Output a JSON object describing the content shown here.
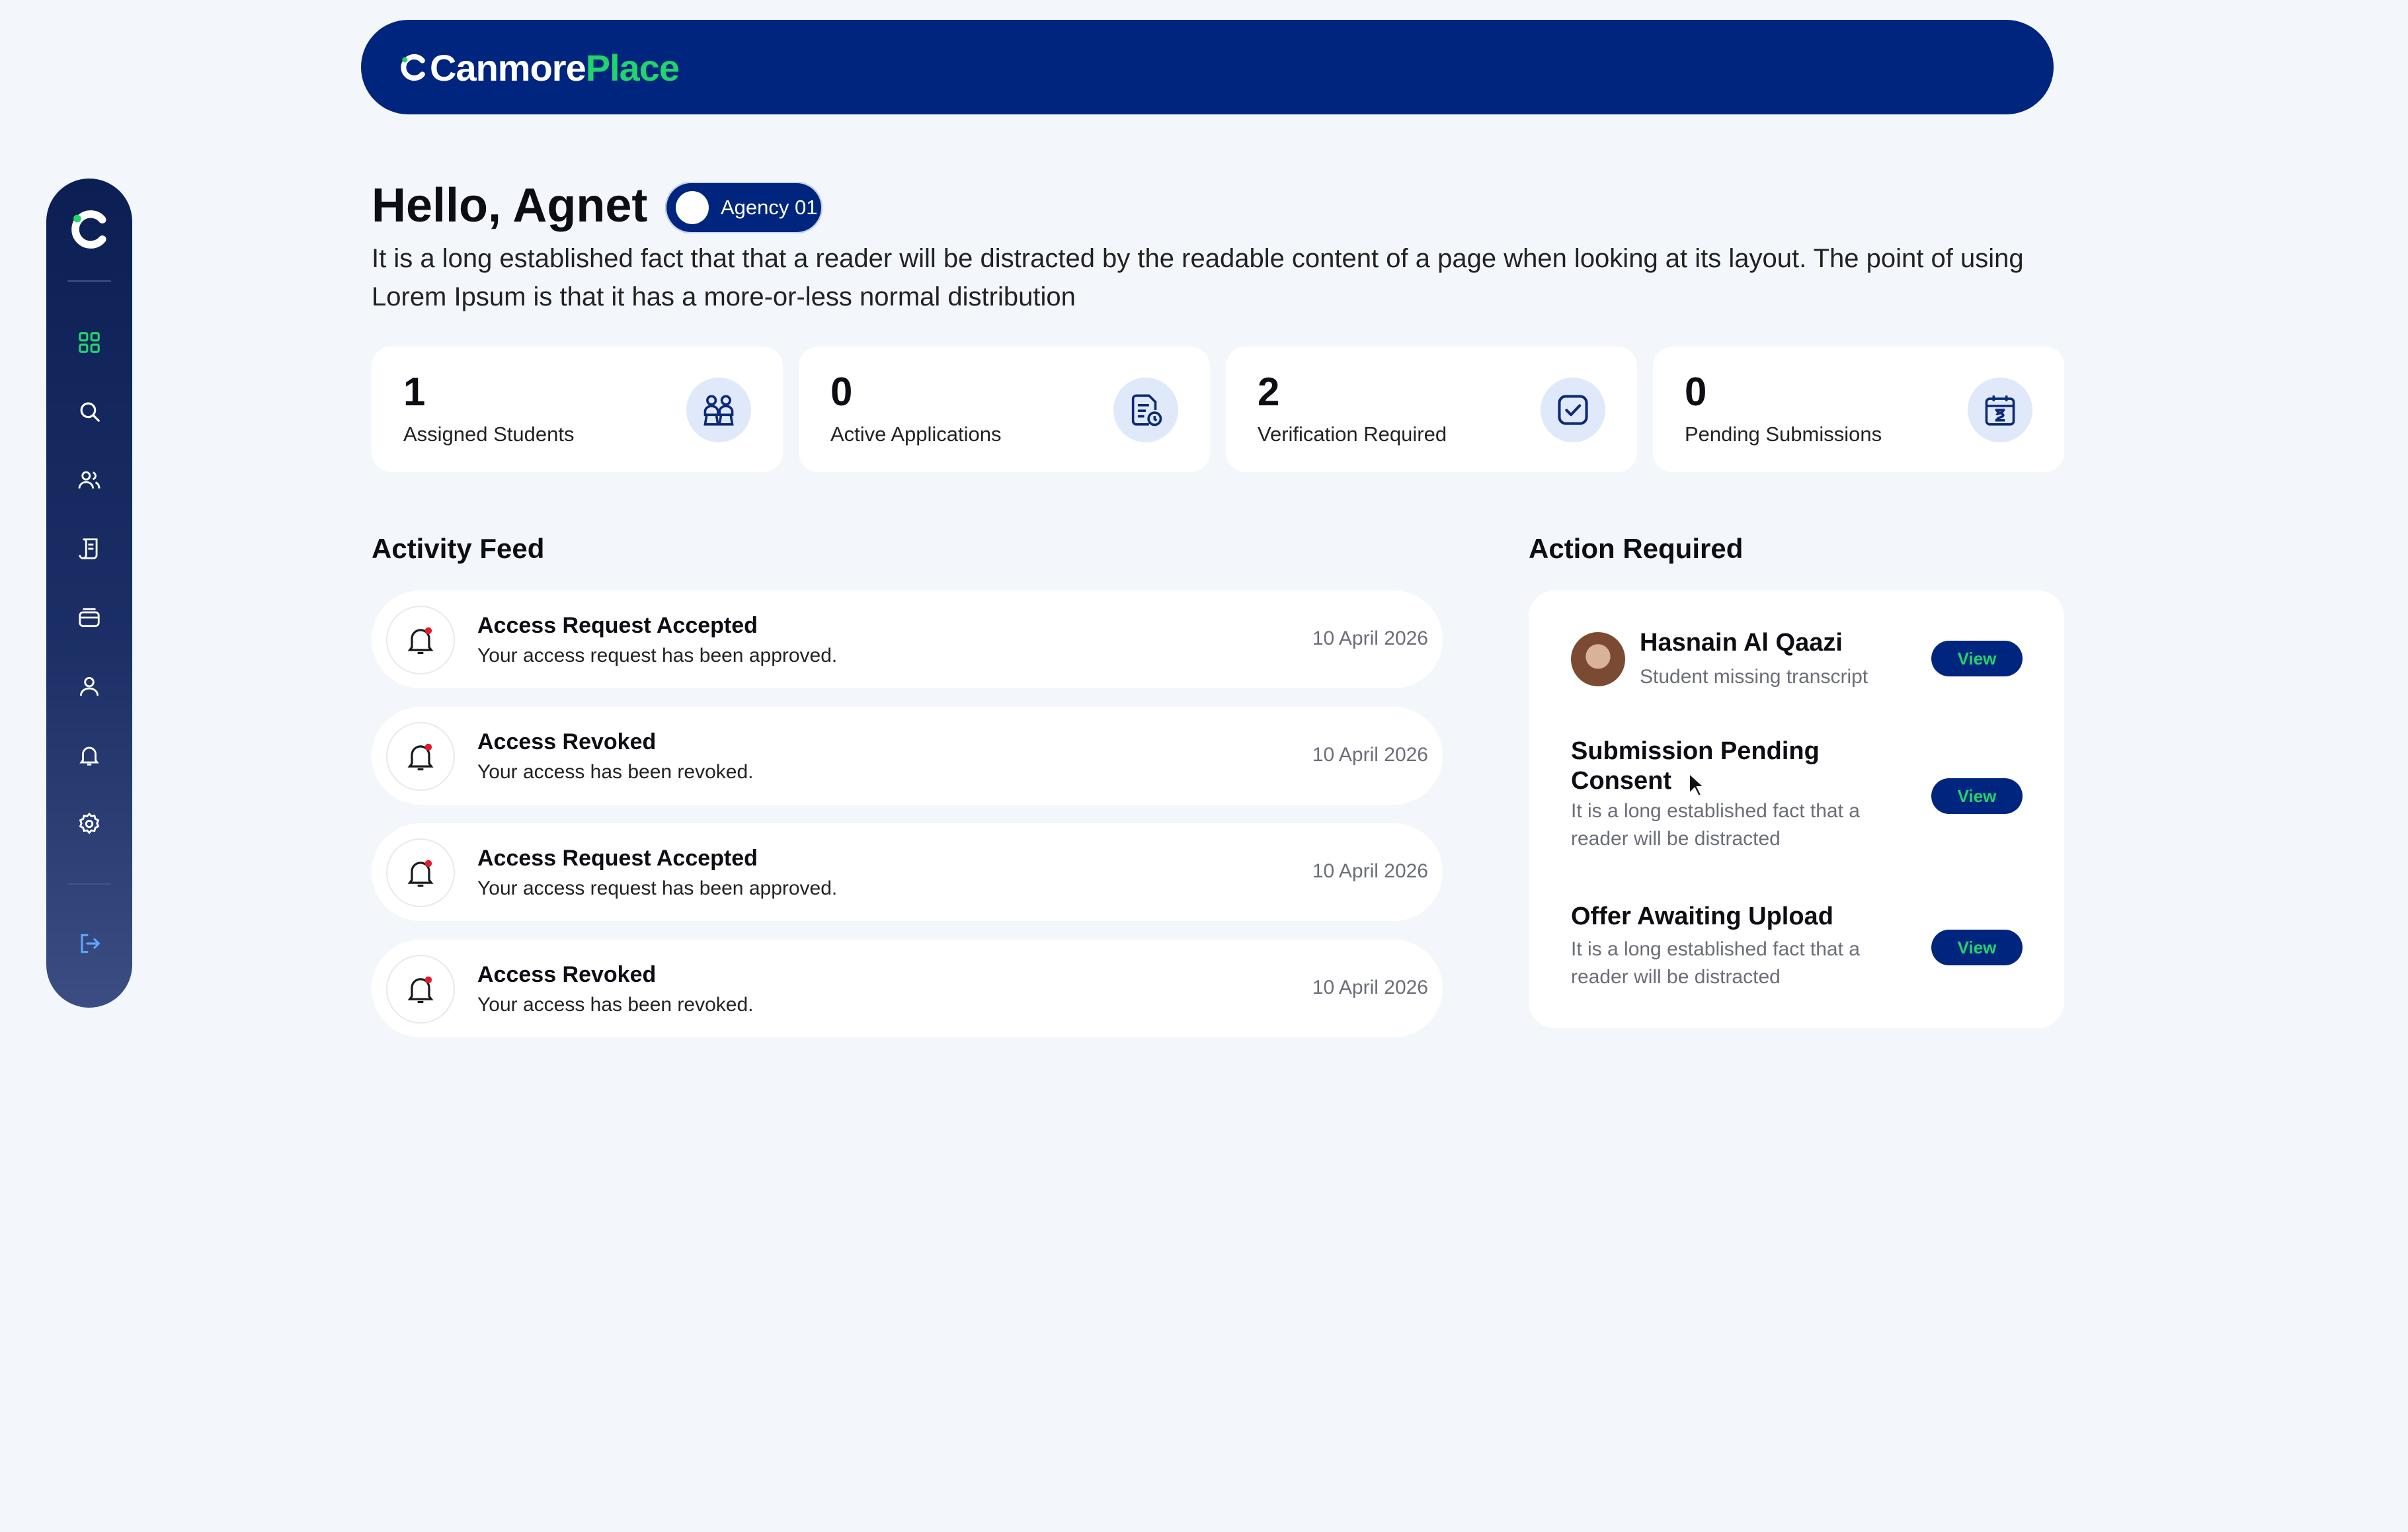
{
  "brand": {
    "name_part1": "Canmore",
    "name_part2": "Place",
    "accent": "#22d46b",
    "primary": "#00257e"
  },
  "sidebar": {
    "items": [
      {
        "icon": "dashboard-icon",
        "active": true
      },
      {
        "icon": "search-icon"
      },
      {
        "icon": "users-icon"
      },
      {
        "icon": "document-list-icon"
      },
      {
        "icon": "inbox-icon"
      },
      {
        "icon": "user-icon"
      },
      {
        "icon": "bell-icon"
      },
      {
        "icon": "gear-icon"
      },
      {
        "icon": "logout-icon"
      }
    ]
  },
  "greeting": {
    "title": "Hello, Agnet",
    "agency": "Agency 01",
    "intro": "It is a long established fact that that a reader will be distracted by the readable content of a page when looking at its layout. The point of using Lorem Ipsum is that it has a more-or-less normal distribution"
  },
  "stats": [
    {
      "value": "1",
      "label": "Assigned Students",
      "icon": "students-icon"
    },
    {
      "value": "0",
      "label": "Active Applications",
      "icon": "application-icon"
    },
    {
      "value": "2",
      "label": "Verification Required",
      "icon": "verify-check-icon"
    },
    {
      "value": "0",
      "label": "Pending Submissions",
      "icon": "calendar-pending-icon"
    }
  ],
  "activity": {
    "title": "Activity Feed",
    "items": [
      {
        "title": "Access Request Accepted",
        "subtitle": "Your access request has been approved.",
        "date": "10 April 2026"
      },
      {
        "title": "Access Revoked",
        "subtitle": "Your access has been revoked.",
        "date": "10 April 2026"
      },
      {
        "title": "Access Request Accepted",
        "subtitle": "Your access request has been approved.",
        "date": "10 April 2026"
      },
      {
        "title": "Access Revoked",
        "subtitle": "Your access has been revoked.",
        "date": "10 April 2026"
      }
    ]
  },
  "actions": {
    "title": "Action Required",
    "items": [
      {
        "title": "Hasnain Al Qaazi",
        "subtitle": "Student missing transcript",
        "button": "View"
      },
      {
        "title_line1": "Submission Pending",
        "title_line2": "Consent",
        "subtitle_line1": "It is a long established fact that a",
        "subtitle_line2": "reader will be distracted",
        "button": "View"
      },
      {
        "title": "Offer Awaiting Upload",
        "subtitle_line1": "It is a long established fact that a",
        "subtitle_line2": "reader will be distracted",
        "button": "View"
      }
    ]
  }
}
